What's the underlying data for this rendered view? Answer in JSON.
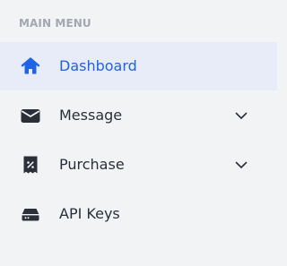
{
  "sidebar": {
    "section_title": "MAIN MENU",
    "items": [
      {
        "label": "Dashboard",
        "icon": "home-icon",
        "active": true,
        "expandable": false
      },
      {
        "label": "Message",
        "icon": "envelope-icon",
        "active": false,
        "expandable": true
      },
      {
        "label": "Purchase",
        "icon": "receipt-icon",
        "active": false,
        "expandable": true
      },
      {
        "label": "API Keys",
        "icon": "server-drive-icon",
        "active": false,
        "expandable": false
      }
    ]
  },
  "colors": {
    "background": "#f2f3f5",
    "active_background": "#e7ecf8",
    "accent": "#1f63e6",
    "text": "#2a2f3a",
    "section_title": "#a3a7b0"
  }
}
